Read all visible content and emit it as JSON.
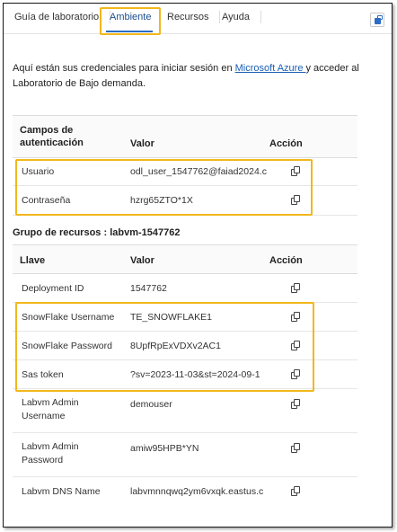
{
  "tabs": [
    {
      "label": "Guía de laboratorio"
    },
    {
      "label": "Ambiente"
    },
    {
      "label": "Recursos"
    },
    {
      "label": "Ayuda"
    }
  ],
  "intro": {
    "before": "Aquí están sus credenciales para iniciar sesión en ",
    "link": "Microsoft Azure ",
    "after": "y acceder al Laboratorio de Bajo demanda."
  },
  "auth_table": {
    "col_field": "Campos de autenticación",
    "col_value": "Valor",
    "col_action": "Acción",
    "rows": [
      {
        "label": "Usuario",
        "value": "odl_user_1547762@faiad2024.c"
      },
      {
        "label": "Contraseña",
        "value": "hzrg65ZTO*1X"
      }
    ]
  },
  "group": {
    "title": "Grupo de recursos : labvm-1547762",
    "col_key": "Llave",
    "col_value": "Valor",
    "col_action": "Acción",
    "rows": [
      {
        "label": "Deployment ID",
        "value": "1547762"
      },
      {
        "label": "SnowFlake Username",
        "value": "TE_SNOWFLAKE1"
      },
      {
        "label": "SnowFlake Password",
        "value": "8UpfRpExVDXv2AC1"
      },
      {
        "label": "Sas token",
        "value": "?sv=2023-11-03&st=2024-09-1"
      },
      {
        "label": "Labvm Admin Username",
        "value": "demouser"
      },
      {
        "label": "Labvm Admin Password",
        "value": "amiw95HPB*YN"
      },
      {
        "label": "Labvm DNS Name",
        "value": "labvmnnqwq2ym6vxqk.eastus.c"
      }
    ]
  },
  "accent_colors": {
    "highlight": "#f2b71c",
    "link": "#1a5fb4",
    "active_tab": "#2b6cc4"
  }
}
